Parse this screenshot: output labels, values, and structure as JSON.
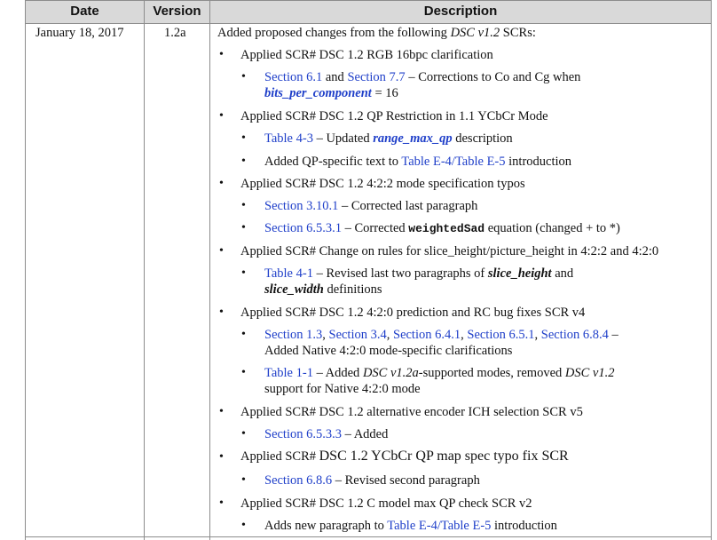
{
  "header": {
    "date": "Date",
    "version": "Version",
    "description": "Description"
  },
  "row": {
    "date": "January 18, 2017",
    "version": "1.2a",
    "intro_a": "Added proposed changes from the following ",
    "intro_b": "DSC v1.2",
    "intro_c": " SCRs:",
    "items": [
      {
        "text": "Applied SCR# DSC 1.2 RGB 16bpc clarification",
        "sub": [
          {
            "l1a": "Section 6.1",
            "l1b": " and ",
            "l1c": "Section 7.7",
            "l1d": " – Corrections to Co and Cg when",
            "l2a": "bits_per_component",
            "l2b": " = 16"
          }
        ]
      },
      {
        "text": "Applied SCR# DSC 1.2 QP Restriction in 1.1 YCbCr Mode",
        "sub": [
          {
            "a": "Table 4-3",
            "b": " – Updated ",
            "c": "range_max_qp",
            "d": " description"
          },
          {
            "a": "Added QP-specific text to ",
            "b": "Table E-4/Table E-5",
            "c": " introduction"
          }
        ]
      },
      {
        "text": "Applied SCR# DSC 1.2 4:2:2 mode specification typos",
        "sub": [
          {
            "a": "Section 3.10.1",
            "b": " – Corrected last paragraph"
          },
          {
            "a": "Section 6.5.3.1",
            "b": " – Corrected ",
            "c": "weightedSad",
            "d": " equation (changed + to *)"
          }
        ]
      },
      {
        "text": "Applied SCR# Change on rules for slice_height/picture_height in 4:2:2 and 4:2:0",
        "sub": [
          {
            "a": "Table 4-1",
            "b": " – Revised last two paragraphs of ",
            "c": "slice_height",
            "d": " and",
            "e": "slice_width",
            "f": " definitions"
          }
        ]
      },
      {
        "text": "Applied SCR# DSC 1.2 4:2:0 prediction and RC bug fixes SCR v4",
        "sub": [
          {
            "a": "Section 1.3",
            "sep1": ", ",
            "b": "Section 3.4",
            "sep2": ", ",
            "c": "Section 6.4.1",
            "sep3": ", ",
            "d": "Section 6.5.1",
            "sep4": ", ",
            "e": "Section 6.8.4",
            "f": " –",
            "g": "Added Native 4:2:0 mode-specific clarifications"
          },
          {
            "a": "Table 1-1",
            "b": " – Added ",
            "c": "DSC v1.2a",
            "d": "-supported modes, removed ",
            "e": "DSC v1.2",
            "f": "support for Native 4:2:0 mode"
          }
        ]
      },
      {
        "text": "Applied SCR# DSC 1.2 alternative encoder ICH selection SCR v5",
        "sub": [
          {
            "a": "Section 6.5.3.3",
            "b": " – Added"
          }
        ]
      },
      {
        "text_a": "Applied SCR# ",
        "text_b": "DSC 1.2 YCbCr QP map spec typo fix SCR",
        "sub": [
          {
            "a": "Section 6.8.6",
            "b": " – Revised second paragraph"
          }
        ]
      },
      {
        "text": "Applied SCR# DSC 1.2 C model max QP check SCR v2",
        "sub": [
          {
            "a": "Adds new paragraph to ",
            "b": "Table E-4/Table E-5",
            "c": " introduction"
          }
        ]
      }
    ]
  },
  "bullet": "•"
}
